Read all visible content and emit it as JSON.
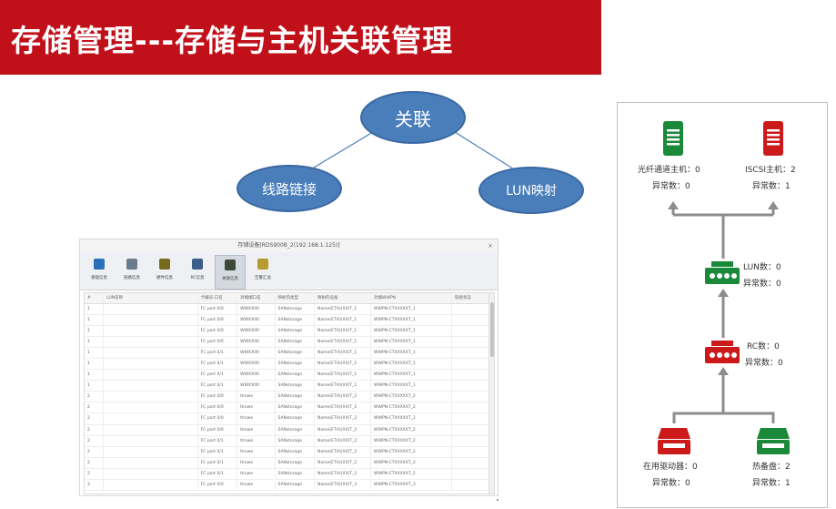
{
  "header": {
    "title": "存储管理---存储与主机关联管理"
  },
  "mindmap": {
    "center": "关联",
    "left": "线路链接",
    "right": "LUN映射"
  },
  "window": {
    "title": "存储设备[RDS900B_2(192.168.1.125)]",
    "toolbar": [
      {
        "label": "基础信息",
        "color": "#2a6fb8",
        "active": false
      },
      {
        "label": "链路信息",
        "color": "#6a7b8c",
        "active": false
      },
      {
        "label": "硬件信息",
        "color": "#7a6a20",
        "active": false
      },
      {
        "label": "RC信息",
        "color": "#3b5d8a",
        "active": false
      },
      {
        "label": "关联信息",
        "color": "#3d4a3a",
        "active": true
      },
      {
        "label": "告警汇总",
        "color": "#b79a30",
        "active": false
      }
    ],
    "columns": [
      "#",
      "LUN名称",
      "卡编号-口名",
      "对端端口名",
      "映射的类型",
      "映射的设备",
      "对端WWPN",
      "链接状态"
    ],
    "rows": [
      [
        "1",
        "",
        "FC port 0/0",
        "WWXX00",
        "SANstorage",
        "Name(ETH)(XX)T_1",
        "WWPN-CTXXXXXT_1",
        ""
      ],
      [
        "1",
        "",
        "FC port 0/0",
        "WWXX00",
        "SANstorage",
        "Name(ETH)(XX)T_1",
        "WWPN-CTXXXXXT_1",
        ""
      ],
      [
        "1",
        "",
        "FC port 0/0",
        "WWXX00",
        "SANstorage",
        "Name(ETH)(XX)T_1",
        "WWPN-CTXXXXXT_1",
        ""
      ],
      [
        "1",
        "",
        "FC port 0/0",
        "WWXX00",
        "SANstorage",
        "Name(ETH)(XX)T_1",
        "WWPN-CTXXXXXT_1",
        ""
      ],
      [
        "1",
        "",
        "FC port 0/1",
        "WWXX00",
        "SANstorage",
        "Name(ETH)(XX)T_1",
        "WWPN-CTXXXXXT_1",
        ""
      ],
      [
        "1",
        "",
        "FC port 0/1",
        "WWXX00",
        "SANstorage",
        "Name(ETH)(XX)T_1",
        "WWPN-CTXXXXXT_1",
        ""
      ],
      [
        "1",
        "",
        "FC port 0/1",
        "WWXX00",
        "SANstorage",
        "Name(ETH)(XX)T_1",
        "WWPN-CTXXXXXT_1",
        ""
      ],
      [
        "1",
        "",
        "FC port 0/1",
        "WWXX00",
        "SANstorage",
        "Name(ETH)(XX)T_1",
        "WWPN-CTXXXXXT_1",
        ""
      ],
      [
        "2",
        "",
        "FC port 0/0",
        "ltrowe",
        "SANstorage",
        "Name(ETH)(XX)T_2",
        "WWPN-CTXXXXXT_2",
        ""
      ],
      [
        "2",
        "",
        "FC port 0/0",
        "ltrowe",
        "SANstorage",
        "Name(ETH)(XX)T_2",
        "WWPN-CTXXXXXT_2",
        ""
      ],
      [
        "2",
        "",
        "FC port 0/0",
        "ltrowe",
        "SANstorage",
        "Name(ETH)(XX)T_2",
        "WWPN-CTXXXXXT_2",
        ""
      ],
      [
        "2",
        "",
        "FC port 0/0",
        "ltrowe",
        "SANstorage",
        "Name(ETH)(XX)T_2",
        "WWPN-CTXXXXXT_2",
        ""
      ],
      [
        "2",
        "",
        "FC port 0/1",
        "ltrowe",
        "SANstorage",
        "Name(ETH)(XX)T_2",
        "WWPN-CTXXXXXT_2",
        ""
      ],
      [
        "2",
        "",
        "FC port 0/1",
        "ltrowe",
        "SANstorage",
        "Name(ETH)(XX)T_2",
        "WWPN-CTXXXXXT_2",
        ""
      ],
      [
        "2",
        "",
        "FC port 0/1",
        "ltrowe",
        "SANstorage",
        "Name(ETH)(XX)T_2",
        "WWPN-CTXXXXXT_2",
        ""
      ],
      [
        "2",
        "",
        "FC port 0/1",
        "ltrowe",
        "SANstorage",
        "Name(ETH)(XX)T_2",
        "WWPN-CTXXXXXT_2",
        ""
      ],
      [
        "3",
        "",
        "FC port 0/0",
        "ltrowe",
        "SANstorage",
        "Name(ETH)(XX)T_3",
        "WWPN-CTXXXXXT_3",
        ""
      ]
    ]
  },
  "topology": {
    "fc_host": {
      "name": "光纤通道主机：0",
      "abnormal": "异常数：0",
      "color": "#1a8a3a"
    },
    "iscsi_host": {
      "name": "ISCSI主机：2",
      "abnormal": "异常数：1",
      "color": "#cc1a1a"
    },
    "lun": {
      "name": "LUN数：0",
      "abnormal": "异常数：0",
      "color": "#1a8a3a"
    },
    "rc": {
      "name": "RC数：0",
      "abnormal": "异常数：0",
      "color": "#cc1a1a"
    },
    "drives": {
      "name": "在用驱动器：0",
      "abnormal": "异常数：0",
      "color": "#cc1a1a"
    },
    "hot_spare": {
      "name": "热备盘：2",
      "abnormal": "异常数：1",
      "color": "#1a8a3a"
    },
    "line_color": "#8c8c8c"
  }
}
